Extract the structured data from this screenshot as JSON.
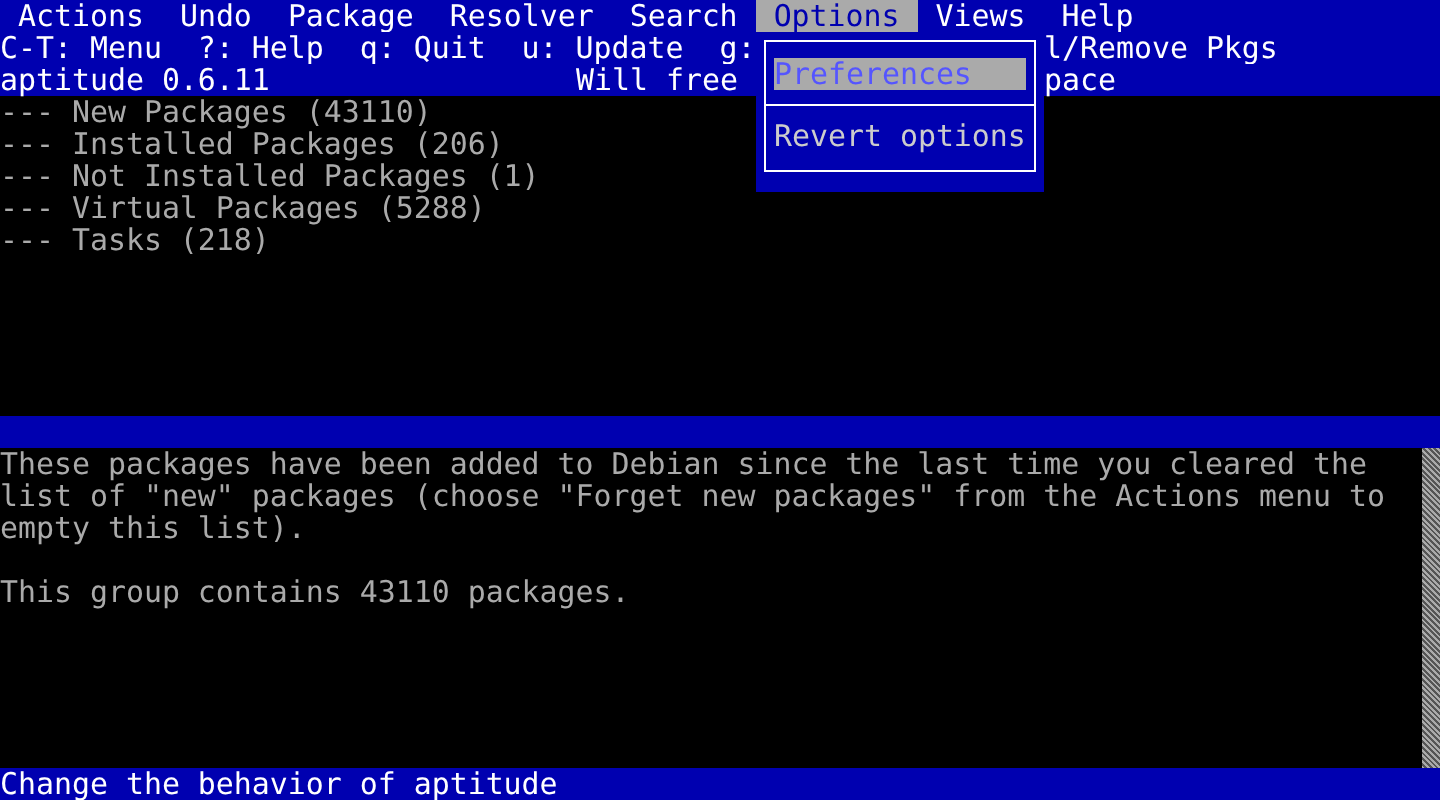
{
  "menu_bar": [
    {
      "label": "Actions",
      "selected": false
    },
    {
      "label": "Undo",
      "selected": false
    },
    {
      "label": "Package",
      "selected": false
    },
    {
      "label": "Resolver",
      "selected": false
    },
    {
      "label": "Search",
      "selected": false
    },
    {
      "label": "Options",
      "selected": true
    },
    {
      "label": "Views",
      "selected": false
    },
    {
      "label": "Help",
      "selected": false
    }
  ],
  "key_hints": {
    "left": "C-T: Menu  ?: Help  q: Quit  u: Update  g:",
    "right": "l/Remove Pkgs"
  },
  "header": {
    "version": "aptitude 0.6.11",
    "middle": "Will free",
    "right": "pace"
  },
  "dropdown": {
    "items": [
      {
        "kind": "item",
        "label": "Preferences",
        "selected": true
      },
      {
        "kind": "separator"
      },
      {
        "kind": "item",
        "label": "Revert options",
        "selected": false
      }
    ]
  },
  "tree": [
    {
      "label": "--- New Packages (43110)"
    },
    {
      "label": "--- Installed Packages (206)"
    },
    {
      "label": "--- Not Installed Packages (1)"
    },
    {
      "label": "--- Virtual Packages (5288)"
    },
    {
      "label": "--- Tasks (218)"
    }
  ],
  "description": [
    "These packages have been added to Debian since the last time you cleared the list of \"new\" packages (choose \"Forget new packages\" from the Actions menu to empty this list).",
    "This group contains 43110 packages."
  ],
  "status_bar": "Change the behavior of aptitude"
}
